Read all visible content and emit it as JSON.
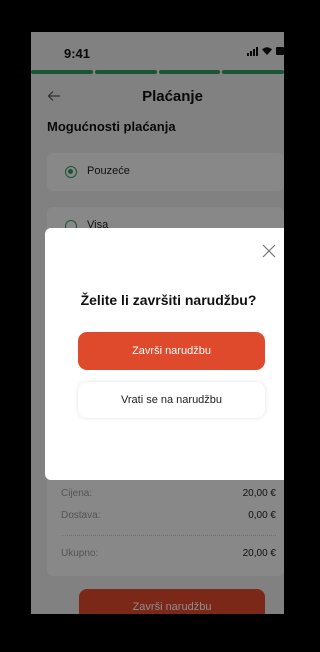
{
  "status_bar": {
    "time": "9:41",
    "icons": [
      "signal-icon",
      "wifi-icon",
      "battery-icon"
    ]
  },
  "progress": {
    "steps_total": 4,
    "steps_done": 4,
    "color": "#2f9c63"
  },
  "header": {
    "title": "Plaćanje",
    "back_icon": "arrow-left-icon"
  },
  "payment": {
    "section_title": "Mogućnosti plaćanja",
    "options": [
      {
        "label": "Pouzeće",
        "selected": true
      },
      {
        "label": "Visa",
        "selected": false
      }
    ]
  },
  "summary": {
    "price_label": "Cijena:",
    "price_value": "20,00 €",
    "delivery_label": "Dostava:",
    "delivery_value": "0,00 €",
    "total_label": "Ukupno:",
    "total_value": "20,00 €"
  },
  "bottom_button": {
    "label": "Završi narudžbu"
  },
  "modal": {
    "title": "Želite li završiti narudžbu?",
    "primary_label": "Završi narudžbu",
    "secondary_label": "Vrati se na narudžbu",
    "close_icon": "close-icon"
  },
  "colors": {
    "accent": "#e04a2c",
    "success": "#2f9c63"
  }
}
